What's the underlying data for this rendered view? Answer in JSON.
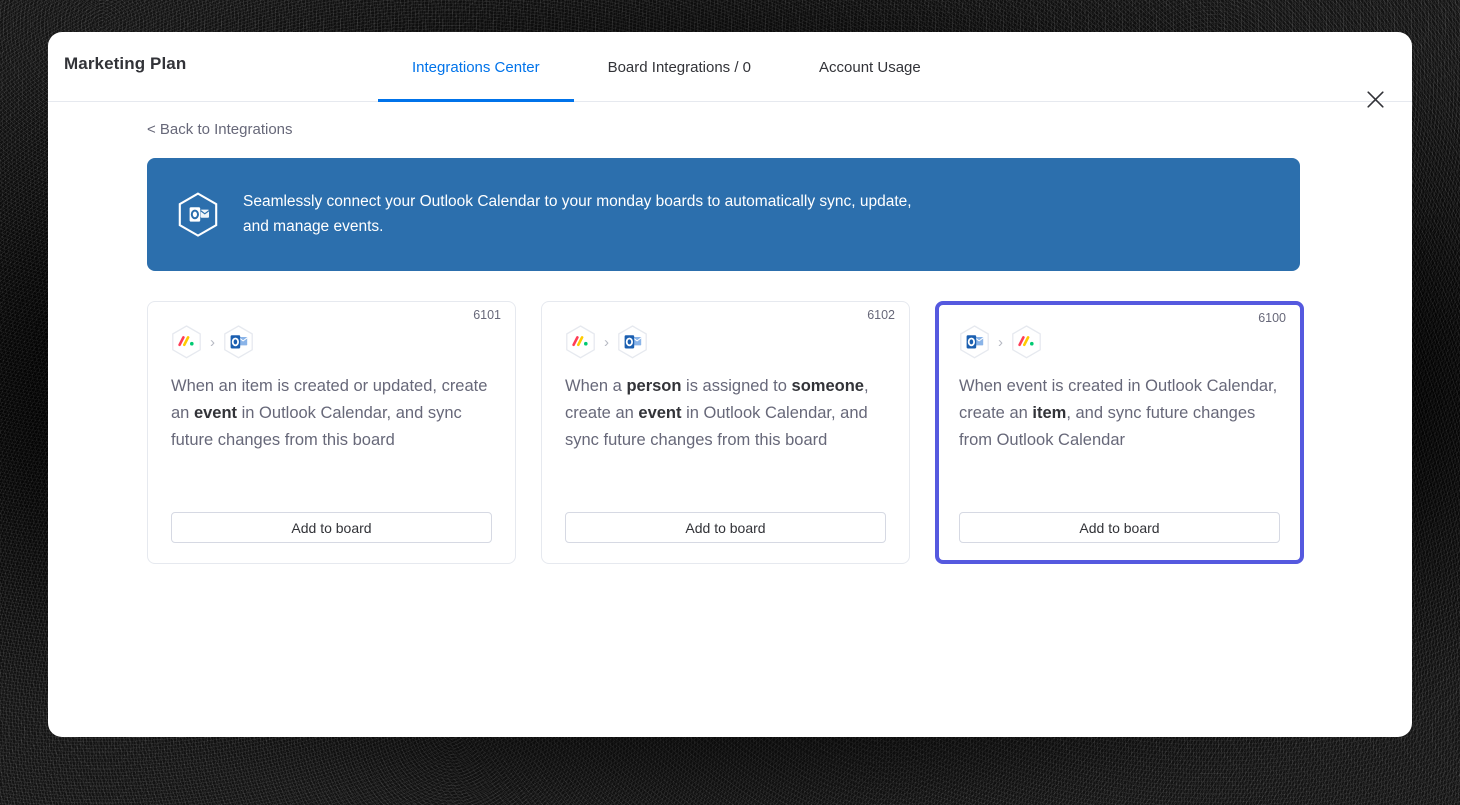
{
  "window": {
    "board_title": "Marketing Plan",
    "close_label": "close-icon"
  },
  "tabs": [
    {
      "label": "Integrations Center",
      "active": true
    },
    {
      "label": "Board Integrations / 0",
      "active": false
    },
    {
      "label": "Account Usage",
      "active": false
    }
  ],
  "back_link": "< Back to Integrations",
  "banner": {
    "icon": "outlook-hexagon-icon",
    "text": "Seamlessly connect your Outlook Calendar to your monday boards to automatically sync, update, and manage events.",
    "background_color": "#2c6fad"
  },
  "colors": {
    "accent_blue": "#0073ea",
    "banner_blue": "#2c6fad",
    "selected_border": "#5559df",
    "text_primary": "#323338",
    "text_secondary": "#676879"
  },
  "cards": [
    {
      "id": "6101",
      "from_icon": "monday-logo-icon",
      "to_icon": "outlook-icon",
      "description_parts": [
        {
          "text": "When an item is created or updated, create an ",
          "bold": false
        },
        {
          "text": "event",
          "bold": true
        },
        {
          "text": " in Outlook Calendar, and sync future changes from this board",
          "bold": false
        }
      ],
      "button_label": "Add to board",
      "selected": false
    },
    {
      "id": "6102",
      "from_icon": "monday-logo-icon",
      "to_icon": "outlook-icon",
      "description_parts": [
        {
          "text": "When a ",
          "bold": false
        },
        {
          "text": "person",
          "bold": true
        },
        {
          "text": " is assigned to ",
          "bold": false
        },
        {
          "text": "someone",
          "bold": true
        },
        {
          "text": ", create an ",
          "bold": false
        },
        {
          "text": "event",
          "bold": true
        },
        {
          "text": " in Outlook Calendar, and sync future changes from this board",
          "bold": false
        }
      ],
      "button_label": "Add to board",
      "selected": false
    },
    {
      "id": "6100",
      "from_icon": "outlook-icon",
      "to_icon": "monday-logo-icon",
      "description_parts": [
        {
          "text": "When event is created in Outlook Calendar, create an ",
          "bold": false
        },
        {
          "text": "item",
          "bold": true
        },
        {
          "text": ", and sync future changes from Outlook Calendar",
          "bold": false
        }
      ],
      "button_label": "Add to board",
      "selected": true
    }
  ]
}
